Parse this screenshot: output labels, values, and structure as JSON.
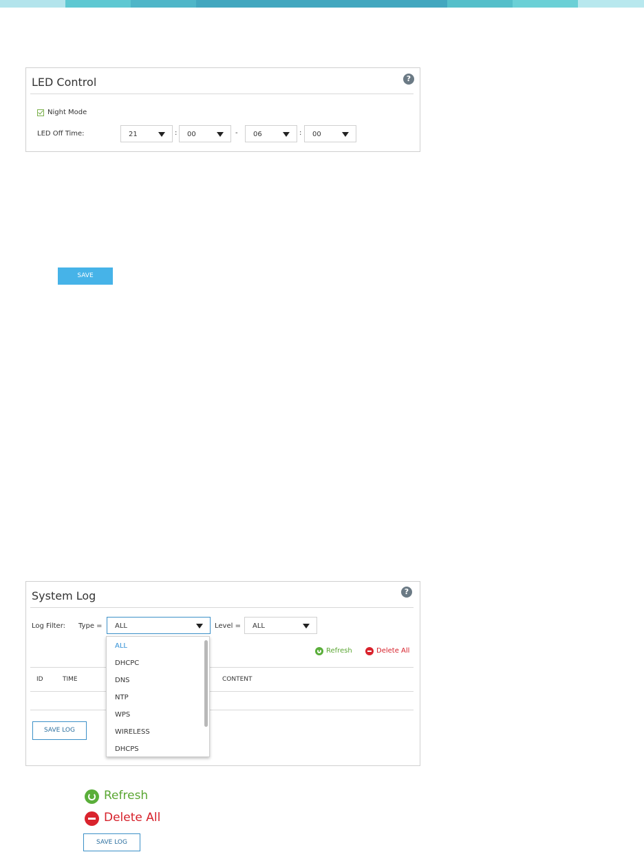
{
  "colors": {
    "accent": "#46b3e8",
    "green": "#5aae3a",
    "red": "#d9232d",
    "topbar": [
      "#b3e4ec",
      "#5ec8d2",
      "#4fb6c8",
      "#43a7bf",
      "#55bfca",
      "#6bd0d6",
      "#b8e8ee"
    ]
  },
  "led_control": {
    "title": "LED Control",
    "help_icon": "?",
    "night_mode_label": "Night Mode",
    "night_mode_checked": true,
    "off_time_label": "LED Off Time:",
    "start_hour": "21",
    "start_minute": "00",
    "end_hour": "06",
    "end_minute": "00",
    "colon": ":",
    "dash": "-"
  },
  "save_button": {
    "label": "SAVE"
  },
  "system_log": {
    "title": "System Log",
    "help_icon": "?",
    "filter_label": "Log Filter:",
    "type_label": "Type =",
    "type_value": "ALL",
    "level_label": "Level =",
    "level_value": "ALL",
    "refresh_label": "Refresh",
    "delete_all_label": "Delete All",
    "columns": [
      "ID",
      "TIME",
      "CONTENT"
    ],
    "save_log_label": "SAVE LOG",
    "type_options": [
      "ALL",
      "DHCPC",
      "DNS",
      "NTP",
      "WPS",
      "WIRELESS",
      "DHCPS"
    ]
  },
  "legend": {
    "refresh_label": "Refresh",
    "delete_all_label": "Delete All",
    "save_log_label": "SAVE LOG"
  }
}
